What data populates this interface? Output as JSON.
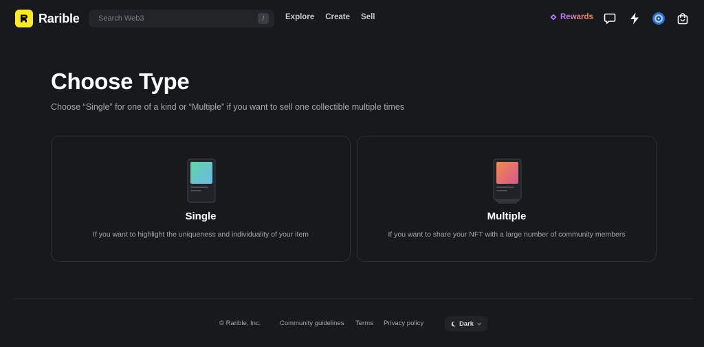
{
  "header": {
    "logo_text": "Rarible",
    "search_placeholder": "Search Web3",
    "search_shortcut": "/",
    "nav": [
      "Explore",
      "Create",
      "Sell"
    ],
    "rewards_label": "Rewards"
  },
  "main": {
    "title": "Choose Type",
    "subtitle": "Choose “Single” for one of a kind or “Multiple” if you want to sell one collectible multiple times",
    "cards": [
      {
        "title": "Single",
        "description": "If you want to highlight the uniqueness and individuality of your item"
      },
      {
        "title": "Multiple",
        "description": "If you want to share your NFT with a large number of community members"
      }
    ]
  },
  "footer": {
    "copyright": "© Rarible, Inc.",
    "links": [
      "Community guidelines",
      "Terms",
      "Privacy policy"
    ],
    "theme_label": "Dark"
  },
  "colors": {
    "background": "#17191c",
    "logo_yellow": "#fee72c",
    "single_gradient": [
      "#5ed6a6",
      "#6fb6e8"
    ],
    "multiple_gradient": [
      "#f08a4b",
      "#d9568f"
    ]
  },
  "icons": [
    "search-icon",
    "diamond-icon",
    "chat-icon",
    "lightning-icon",
    "avatar",
    "bag-icon",
    "moon-icon",
    "chevron-down-icon"
  ]
}
